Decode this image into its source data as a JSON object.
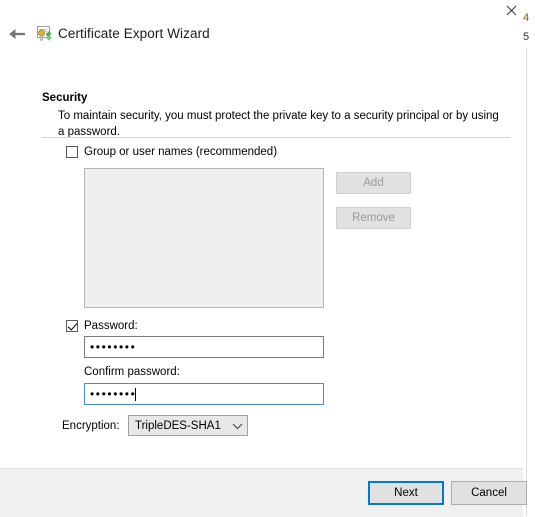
{
  "window": {
    "title": "Certificate Export Wizard",
    "icon": "certificate-wizard-icon",
    "back_icon": "back-arrow-icon",
    "close_icon": "close-icon"
  },
  "background_window": {
    "glyph_top": "4",
    "glyph_bottom": "5"
  },
  "page": {
    "heading": "Security",
    "description": "To maintain security, you must protect the private key to a security principal or by using a password."
  },
  "group_names": {
    "label": "Group or user names (recommended)",
    "checked": false,
    "list_items": [],
    "add_label": "Add",
    "add_enabled": false,
    "remove_label": "Remove",
    "remove_enabled": false
  },
  "password": {
    "label": "Password:",
    "checked": true,
    "value": "••••••••",
    "confirm_label": "Confirm password:",
    "confirm_value": "••••••••",
    "confirm_focused": true
  },
  "encryption": {
    "label": "Encryption:",
    "selected": "TripleDES-SHA1",
    "chevron_icon": "chevron-down-icon"
  },
  "footer": {
    "next_label": "Next",
    "cancel_label": "Cancel",
    "next_focused": true
  },
  "colors": {
    "accent": "#0078d7",
    "focus_border": "#3f8fcb",
    "footer_bg": "#f0f0f0",
    "disabled_text": "#9a9a9a"
  }
}
